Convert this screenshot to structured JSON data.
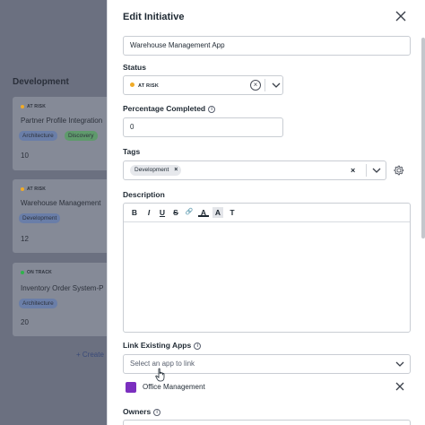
{
  "board": {
    "column_title": "Development",
    "create_link": "+ Create",
    "cards": [
      {
        "status": "AT RISK",
        "status_color": "#f0ab27",
        "name": "Partner Profile Integration",
        "tags": [
          "Architecture",
          "Discovery"
        ],
        "number": "10"
      },
      {
        "status": "AT RISK",
        "status_color": "#f0ab27",
        "name": "Warehouse Management",
        "tags": [
          "Development"
        ],
        "number": "12"
      },
      {
        "status": "ON TRACK",
        "status_color": "#2fb34a",
        "name": "Inventory Order System-P",
        "tags": [
          "Architecture"
        ],
        "number": "20"
      }
    ]
  },
  "panel": {
    "title": "Edit Initiative",
    "close_icon": "close-icon",
    "name_value": "Warehouse Management App",
    "status_label": "Status",
    "status_value": "AT RISK",
    "status_color": "#f0ab27",
    "percentage_label": "Percentage Completed",
    "percentage_value": "0",
    "tags_label": "Tags",
    "tags": [
      "Development"
    ],
    "description_label": "Description",
    "toolbar_buttons": [
      {
        "glyph": "B",
        "icon": "bold-icon"
      },
      {
        "glyph": "I",
        "icon": "italic-icon"
      },
      {
        "glyph": "U",
        "icon": "underline-icon"
      },
      {
        "glyph": "S",
        "icon": "strikethrough-icon"
      },
      {
        "glyph": "🔗",
        "icon": "link-icon"
      },
      {
        "glyph": "A",
        "icon": "text-color-icon"
      },
      {
        "glyph": "A",
        "icon": "highlight-icon"
      },
      {
        "glyph": "T",
        "icon": "clear-format-icon"
      }
    ],
    "link_apps_label": "Link Existing Apps",
    "link_apps_placeholder": "Select an app to link",
    "linked_app_name": "Office Management",
    "owners_label": "Owners"
  }
}
